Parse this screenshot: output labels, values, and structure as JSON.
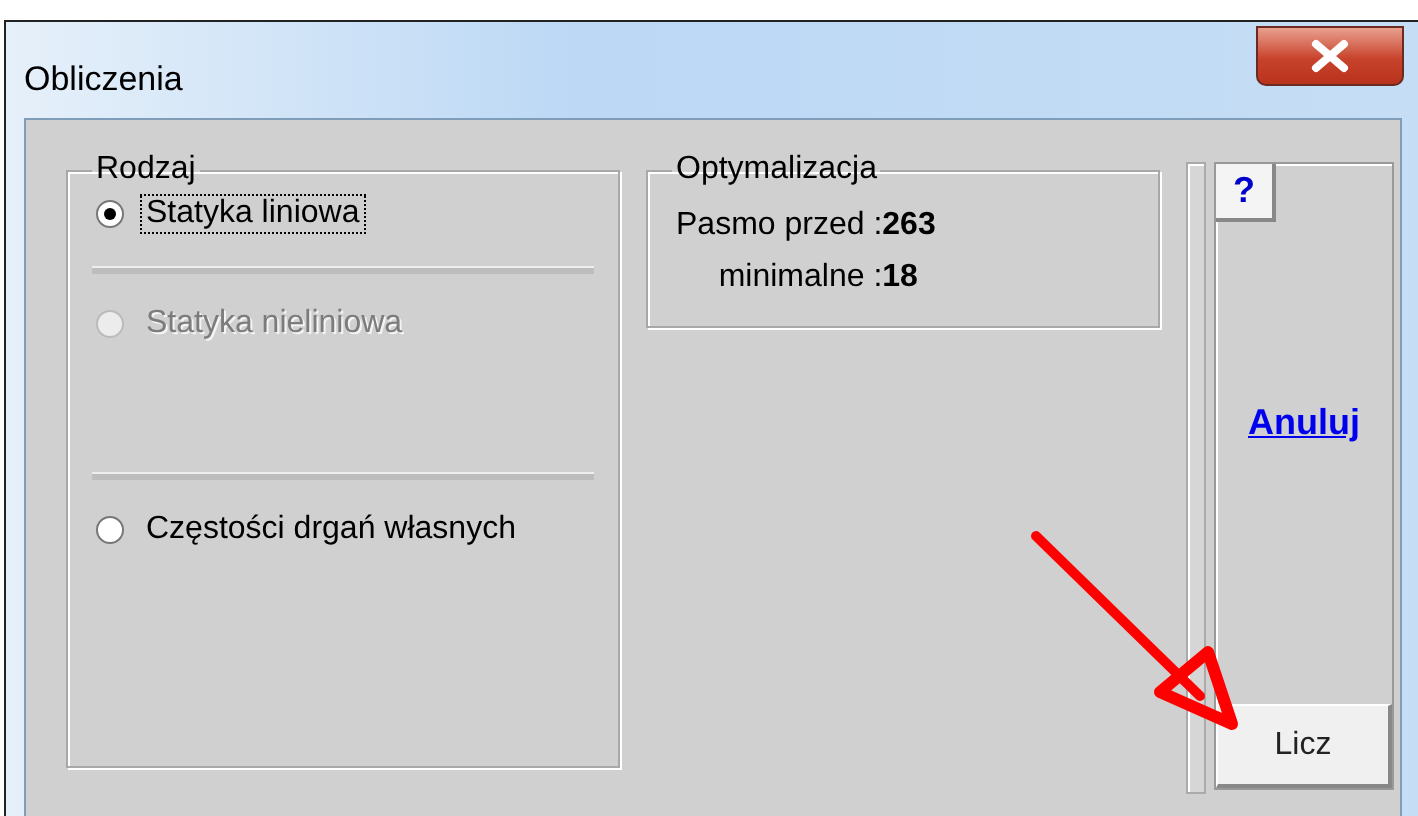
{
  "window": {
    "title": "Obliczenia"
  },
  "rodzaj": {
    "title": "Rodzaj",
    "options": [
      {
        "label": "Statyka liniowa",
        "selected": true,
        "disabled": false,
        "focused": true
      },
      {
        "label": "Statyka nieliniowa",
        "selected": false,
        "disabled": true,
        "focused": false
      },
      {
        "label": "Częstości drgań własnych",
        "selected": false,
        "disabled": false,
        "focused": false
      }
    ]
  },
  "optymalizacja": {
    "title": "Optymalizacja",
    "rows": [
      {
        "label": "Pasmo przed :",
        "value": "263"
      },
      {
        "label": "minimalne :",
        "value": "18"
      }
    ]
  },
  "help_button": "?",
  "cancel_link": "Anuluj",
  "compute_button": "Licz"
}
